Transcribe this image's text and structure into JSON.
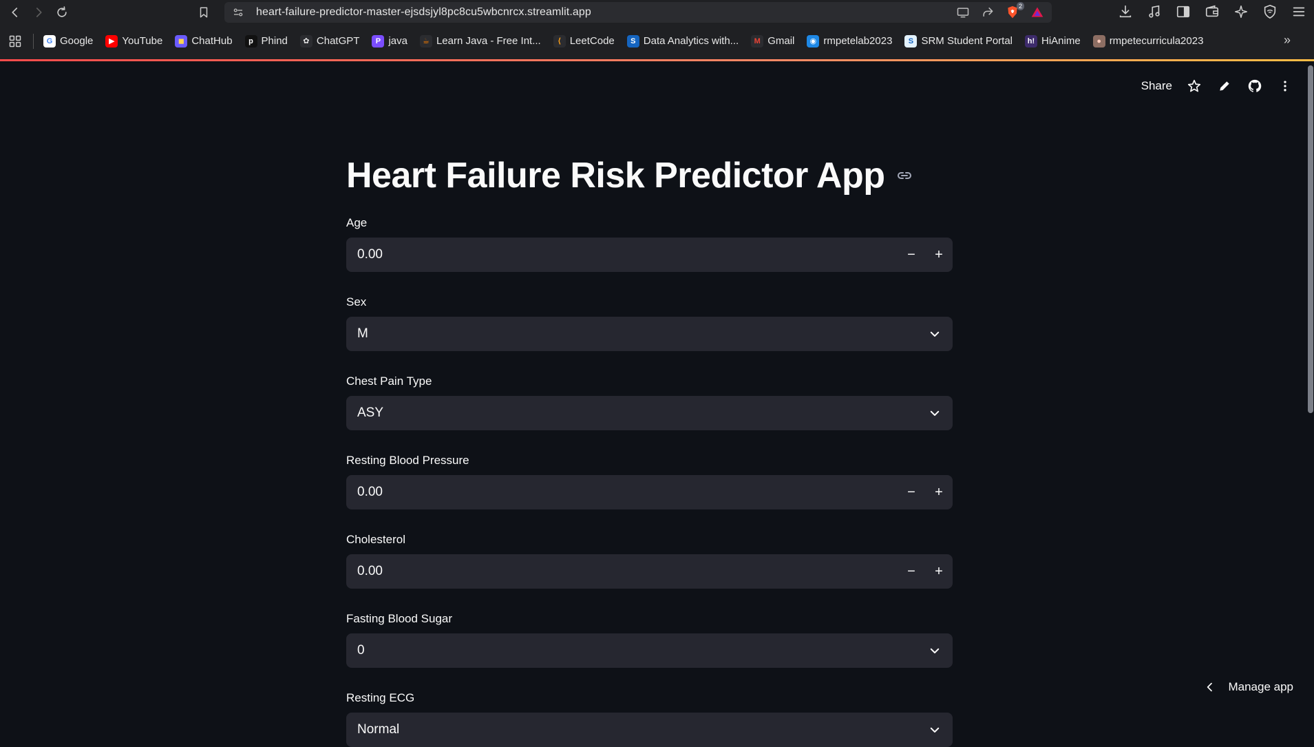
{
  "browser": {
    "url": "heart-failure-predictor-master-ejsdsjyl8pc8cu5wbcnrcx.streamlit.app",
    "brave_shield_count": "2",
    "bookmarks": [
      {
        "label": "Google",
        "icon": "google-icon",
        "color": "#ffffff",
        "glyph": "G",
        "glyph_color": "#4285f4"
      },
      {
        "label": "YouTube",
        "icon": "youtube-icon",
        "color": "#ff0000",
        "glyph": "▶",
        "glyph_color": "#ffffff"
      },
      {
        "label": "ChatHub",
        "icon": "chathub-icon",
        "color": "#6b5bff",
        "glyph": "◼",
        "glyph_color": "#ffd54f"
      },
      {
        "label": "Phind",
        "icon": "phind-icon",
        "color": "#111111",
        "glyph": "p",
        "glyph_color": "#ffffff"
      },
      {
        "label": "ChatGPT",
        "icon": "chatgpt-icon",
        "color": "#2b2c30",
        "glyph": "✿",
        "glyph_color": "#e6e6e6"
      },
      {
        "label": "java",
        "icon": "java-icon",
        "color": "#7b4dff",
        "glyph": "P",
        "glyph_color": "#ffffff"
      },
      {
        "label": "Learn Java - Free Int...",
        "icon": "learn-java-icon",
        "color": "#2b2c30",
        "glyph": "☕",
        "glyph_color": "#f57c00"
      },
      {
        "label": "LeetCode",
        "icon": "leetcode-icon",
        "color": "#2b2c30",
        "glyph": "⟨",
        "glyph_color": "#ffa116"
      },
      {
        "label": "Data Analytics with...",
        "icon": "data-analytics-icon",
        "color": "#1565c0",
        "glyph": "S",
        "glyph_color": "#ffffff"
      },
      {
        "label": "Gmail",
        "icon": "gmail-icon",
        "color": "#2b2c30",
        "glyph": "M",
        "glyph_color": "#ea4335"
      },
      {
        "label": "rmpetelab2023",
        "icon": "rmpetelab-icon",
        "color": "#1e88e5",
        "glyph": "◉",
        "glyph_color": "#ffffff"
      },
      {
        "label": "SRM Student Portal",
        "icon": "srm-portal-icon",
        "color": "#e3f2fd",
        "glyph": "S",
        "glyph_color": "#1565c0"
      },
      {
        "label": "HiAnime",
        "icon": "hianime-icon",
        "color": "#3d2b6b",
        "glyph": "h!",
        "glyph_color": "#ffffff"
      },
      {
        "label": "rmpetecurricula2023",
        "icon": "rmpetecurricula-icon",
        "color": "#8d6e63",
        "glyph": "●",
        "glyph_color": "#ffccbc"
      }
    ]
  },
  "header": {
    "share_label": "Share"
  },
  "app": {
    "title": "Heart Failure Risk Predictor App",
    "fields": {
      "age": {
        "label": "Age",
        "value": "0.00"
      },
      "sex": {
        "label": "Sex",
        "value": "M"
      },
      "chest_pain": {
        "label": "Chest Pain Type",
        "value": "ASY"
      },
      "resting_bp": {
        "label": "Resting Blood Pressure",
        "value": "0.00"
      },
      "cholesterol": {
        "label": "Cholesterol",
        "value": "0.00"
      },
      "fasting_bs": {
        "label": "Fasting Blood Sugar",
        "value": "0"
      },
      "resting_ecg": {
        "label": "Resting ECG",
        "value": "Normal"
      }
    },
    "stepper": {
      "minus": "−",
      "plus": "+"
    }
  },
  "footer": {
    "manage_app_label": "Manage app"
  }
}
